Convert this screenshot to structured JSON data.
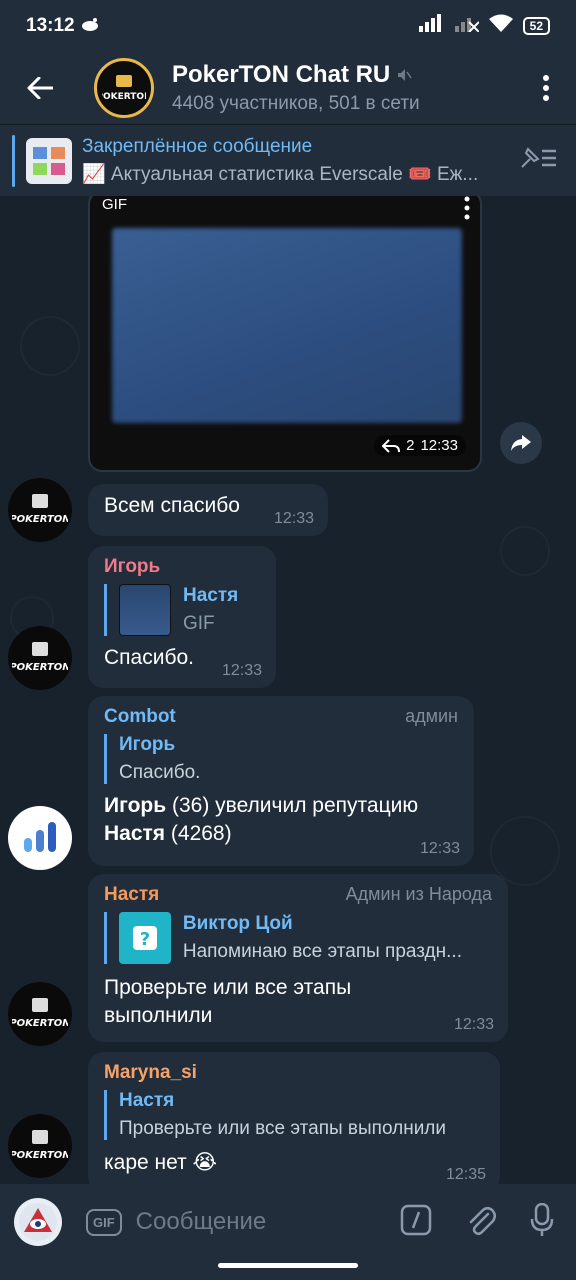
{
  "status": {
    "time": "13:12",
    "battery": "52"
  },
  "header": {
    "title": "PokerTON Chat RU",
    "subtitle": "4408 участников, 501 в сети"
  },
  "pinned": {
    "title": "Закреплённое сообщение",
    "text": "📈 Актуальная статистика Everscale 🎟️ Еж..."
  },
  "gif": {
    "label": "GIF",
    "reply_count": "2",
    "time": "12:33"
  },
  "messages": [
    {
      "text": "Всем спасибо",
      "time": "12:33"
    },
    {
      "sender": "Игорь",
      "reply_name": "Настя",
      "reply_text": "GIF",
      "text": "Спасибо.",
      "time": "12:33"
    },
    {
      "sender": "Combot",
      "role": "админ",
      "reply_name": "Игорь",
      "reply_text": "Спасибо.",
      "line1_bold": "Игорь",
      "line1_rest": " (36) увеличил репутацию",
      "line2_bold": "Настя",
      "line2_rest": " (4268)",
      "time": "12:33"
    },
    {
      "sender": "Настя",
      "role": "Админ из Народа",
      "reply_name": "Виктор Цой",
      "reply_text": "Напоминаю все этапы праздн...",
      "text": "Проверьте или все этапы выполнили",
      "time": "12:33"
    },
    {
      "sender": "Maryna_si",
      "reply_name": "Настя",
      "reply_text": "Проверьте или все этапы выполнили",
      "text": "каре нет 😭",
      "time": "12:35"
    }
  ],
  "input": {
    "gif_label": "GIF",
    "placeholder": "Сообщение"
  },
  "colors": {
    "igor": "#ee7b8a",
    "combot": "#71baf5",
    "nastya": "#f59a5d",
    "maryna": "#f5a36b"
  }
}
